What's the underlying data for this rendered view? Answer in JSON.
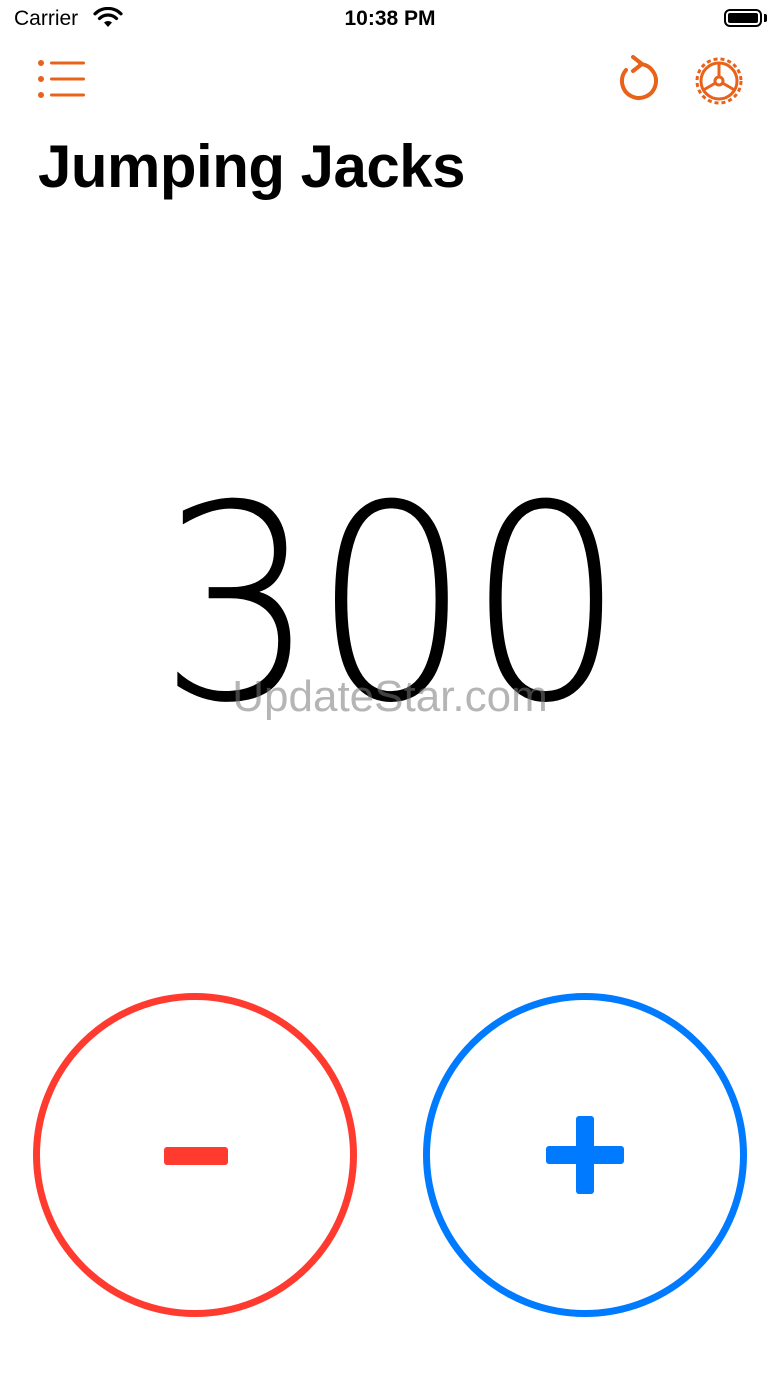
{
  "status_bar": {
    "carrier": "Carrier",
    "time": "10:38 PM"
  },
  "toolbar": {
    "menu_icon": "list-icon",
    "reset_icon": "reset-arrow-icon",
    "settings_icon": "gear-icon",
    "accent_color": "#e8631a"
  },
  "exercise": {
    "title": "Jumping Jacks",
    "count": "300"
  },
  "watermark": "UpdateStar.com",
  "controls": {
    "decrement_color": "#ff3b30",
    "increment_color": "#007aff"
  }
}
